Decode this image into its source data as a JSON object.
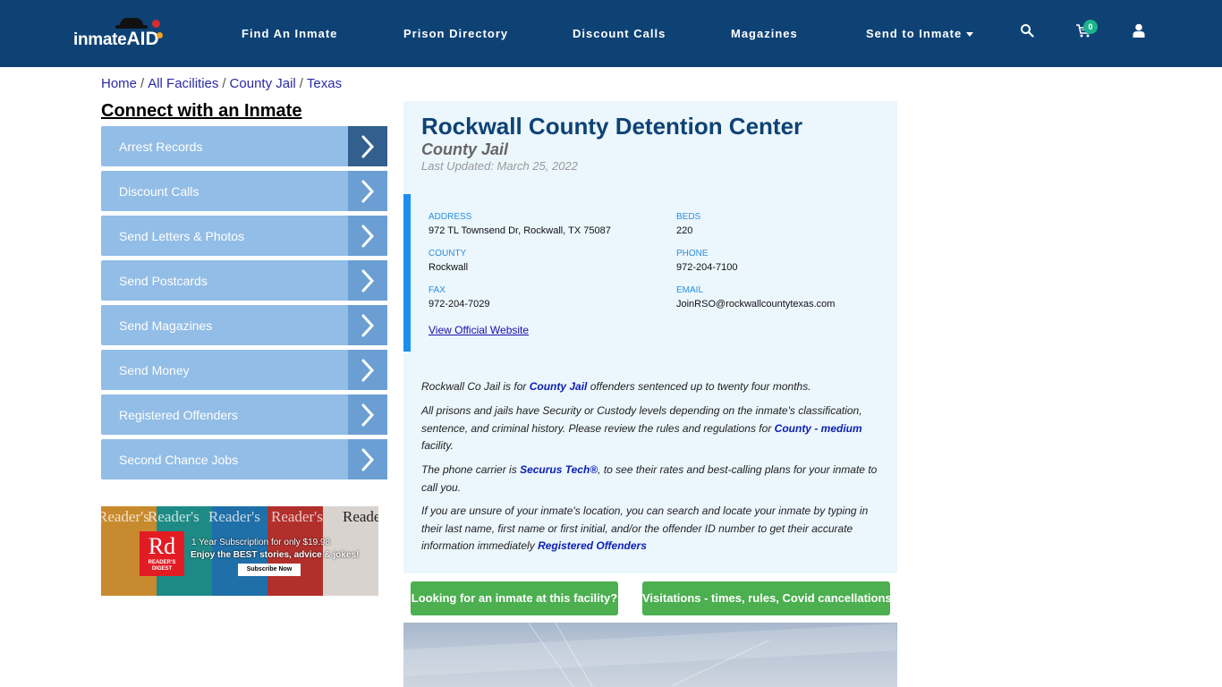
{
  "header": {
    "logo": {
      "text_main": "inmate",
      "text_accent": "AID"
    },
    "nav": [
      {
        "label": "Find An Inmate"
      },
      {
        "label": "Prison Directory"
      },
      {
        "label": "Discount Calls"
      },
      {
        "label": "Magazines"
      },
      {
        "label": "Send to Inmate",
        "has_dropdown": true
      }
    ],
    "icons": {
      "search": "search-icon",
      "cart": "cart-icon",
      "user": "user-icon"
    },
    "cart_count": "0"
  },
  "breadcrumb": [
    {
      "label": "Home"
    },
    {
      "label": "All Facilities"
    },
    {
      "label": "County Jail"
    },
    {
      "label": "Texas"
    }
  ],
  "breadcrumb_separator": "/",
  "sidebar": {
    "title": "Connect with an Inmate",
    "items": [
      {
        "label": "Arrest Records",
        "active": true
      },
      {
        "label": "Discount Calls"
      },
      {
        "label": "Send Letters & Photos"
      },
      {
        "label": "Send Postcards"
      },
      {
        "label": "Send Magazines"
      },
      {
        "label": "Send Money"
      },
      {
        "label": "Registered Offenders"
      },
      {
        "label": "Second Chance Jobs"
      }
    ]
  },
  "ad": {
    "brand_big": "Rd",
    "brand_small_1": "READER'S",
    "brand_small_2": "DIGEST",
    "mastheads": [
      "Reader's",
      "Reader's",
      "Reader's",
      "Reader's",
      "Reade"
    ],
    "line1": "1 Year Subscription for only $19.98",
    "line2": "Enjoy the BEST stories, advice & jokes!",
    "button": "Subscribe Now"
  },
  "facility": {
    "name": "Rockwall County Detention Center",
    "type": "County Jail",
    "last_updated": "Last Updated: March 25, 2022",
    "fields": {
      "address": {
        "label": "ADDRESS",
        "value": "972 TL Townsend Dr, Rockwall, TX 75087"
      },
      "beds": {
        "label": "BEDS",
        "value": "220"
      },
      "county": {
        "label": "COUNTY",
        "value": "Rockwall"
      },
      "phone": {
        "label": "PHONE",
        "value": "972-204-7100"
      },
      "fax": {
        "label": "FAX",
        "value": "972-204-7029"
      },
      "email": {
        "label": "EMAIL",
        "value": "JoinRSO@rockwallcountytexas.com"
      }
    },
    "website_link": "View Official Website"
  },
  "description": {
    "p1": {
      "pre": "Rockwall Co Jail is for ",
      "link": "County Jail",
      "post": " offenders sentenced up to twenty four months."
    },
    "p2": {
      "pre": "All prisons and jails have Security or Custody levels depending on the inmate's classification, sentence, and criminal history. Please review the rules and regulations for ",
      "link": "County - medium",
      "post": " facility."
    },
    "p3": {
      "pre": "The phone carrier is ",
      "link": "Securus Tech®",
      "post": ", to see their rates and best-calling plans for your inmate to call you."
    },
    "p4": {
      "pre": "If you are unsure of your inmate's location, you can search and locate your inmate by typing in their last name, first name or first initial, and/or the offender ID number to get their accurate information immediately ",
      "link": "Registered Offenders",
      "post": ""
    }
  },
  "actions": {
    "find_inmate": "Looking for an inmate at this facility?",
    "visitations": "Visitations - times, rules, Covid cancellations"
  },
  "colors": {
    "header_bg": "#0e4275",
    "sidebar_item": "#92bde6",
    "sidebar_arrow": "#6b9fd3",
    "sidebar_arrow_active": "#325f8d",
    "card_bg": "#ebf6fd",
    "accent_bar": "#1a8ff0",
    "green_button": "#4caf50",
    "title": "#0e4275"
  }
}
